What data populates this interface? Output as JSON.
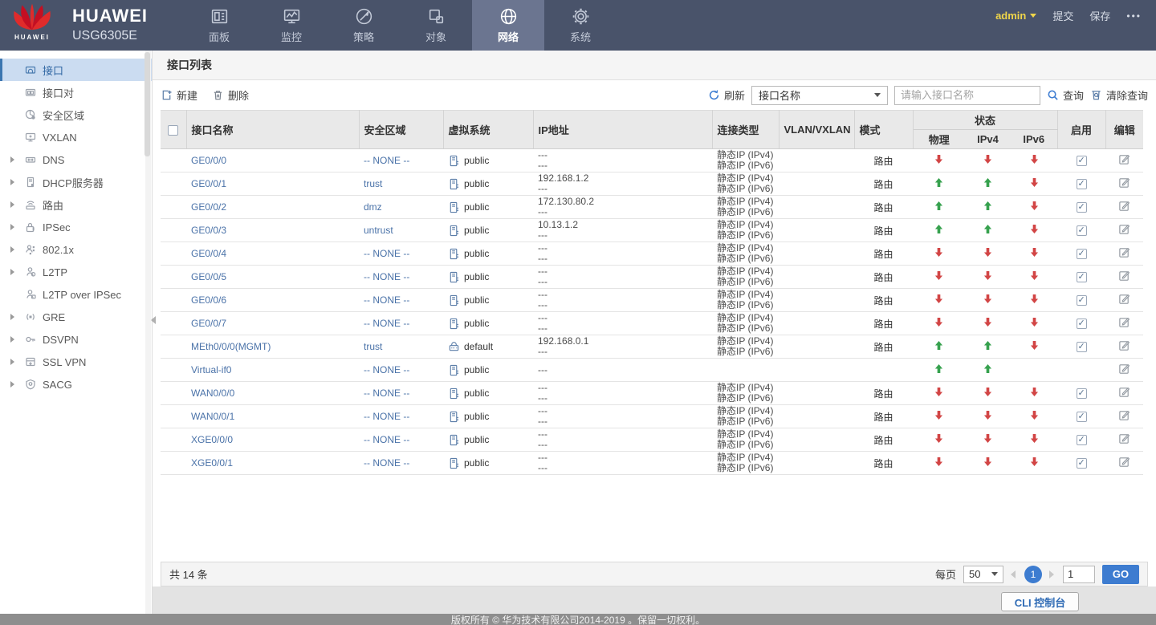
{
  "header": {
    "brand": {
      "logo_caption": "HUAWEI",
      "name": "HUAWEI",
      "model": "USG6305E"
    },
    "nav": [
      {
        "id": "dashboard",
        "label": "面板",
        "icon": "dashboard-icon"
      },
      {
        "id": "monitor",
        "label": "监控",
        "icon": "monitor-icon"
      },
      {
        "id": "policy",
        "label": "策略",
        "icon": "policy-icon"
      },
      {
        "id": "object",
        "label": "对象",
        "icon": "object-icon"
      },
      {
        "id": "network",
        "label": "网络",
        "icon": "network-icon"
      },
      {
        "id": "system",
        "label": "系统",
        "icon": "system-icon"
      }
    ],
    "active_nav": "network",
    "user": "admin",
    "submit_label": "提交",
    "save_label": "保存",
    "more_label": "•••"
  },
  "sidebar": {
    "items": [
      {
        "id": "interface",
        "label": "接口",
        "icon": "interface-icon",
        "active": true,
        "expandable": false
      },
      {
        "id": "interface-pair",
        "label": "接口对",
        "icon": "interface-pair-icon",
        "expandable": false
      },
      {
        "id": "security-zone",
        "label": "安全区域",
        "icon": "zone-icon",
        "expandable": false
      },
      {
        "id": "vxlan",
        "label": "VXLAN",
        "icon": "vxlan-icon",
        "expandable": false
      },
      {
        "id": "dns",
        "label": "DNS",
        "icon": "dns-icon",
        "expandable": true
      },
      {
        "id": "dhcp-server",
        "label": "DHCP服务器",
        "icon": "dhcp-icon",
        "expandable": true
      },
      {
        "id": "route",
        "label": "路由",
        "icon": "route-icon",
        "expandable": true
      },
      {
        "id": "ipsec",
        "label": "IPSec",
        "icon": "ipsec-icon",
        "expandable": true
      },
      {
        "id": "dot1x",
        "label": "802.1x",
        "icon": "dot1x-icon",
        "expandable": true
      },
      {
        "id": "l2tp",
        "label": "L2TP",
        "icon": "l2tp-icon",
        "expandable": true
      },
      {
        "id": "l2tp-over-ipsec",
        "label": "L2TP over IPSec",
        "icon": "l2tp-ipsec-icon",
        "expandable": false
      },
      {
        "id": "gre",
        "label": "GRE",
        "icon": "gre-icon",
        "expandable": true
      },
      {
        "id": "dsvpn",
        "label": "DSVPN",
        "icon": "dsvpn-icon",
        "expandable": true
      },
      {
        "id": "ssl-vpn",
        "label": "SSL VPN",
        "icon": "sslvpn-icon",
        "expandable": true
      },
      {
        "id": "sacg",
        "label": "SACG",
        "icon": "sacg-icon",
        "expandable": true
      }
    ]
  },
  "page": {
    "title": "接口列表"
  },
  "toolbar": {
    "new_label": "新建",
    "delete_label": "删除",
    "refresh_label": "刷新",
    "filter_selected": "接口名称",
    "search_placeholder": "请输入接口名称",
    "query_label": "查询",
    "clear_query_label": "清除查询"
  },
  "table": {
    "columns": {
      "name": "接口名称",
      "zone": "安全区域",
      "vsys": "虚拟系统",
      "ip": "IP地址",
      "conn": "连接类型",
      "vlan": "VLAN/VXLAN",
      "mode": "模式",
      "status": "状态",
      "phy": "物理",
      "ipv4": "IPv4",
      "ipv6": "IPv6",
      "enable": "启用",
      "edit": "编辑"
    },
    "rows": [
      {
        "name": "GE0/0/0",
        "zone": "-- NONE --",
        "vsys": "public",
        "vsys_icon": "vsys-public-icon",
        "ip": [
          "---",
          "---"
        ],
        "conn": [
          "静态IP (IPv4)",
          "静态IP (IPv6)"
        ],
        "vlan": "",
        "mode": "路由",
        "status": {
          "phy": "down",
          "ipv4": "down",
          "ipv6": "down"
        },
        "enabled": true
      },
      {
        "name": "GE0/0/1",
        "zone": "trust",
        "vsys": "public",
        "vsys_icon": "vsys-public-icon",
        "ip": [
          "192.168.1.2",
          "---"
        ],
        "conn": [
          "静态IP (IPv4)",
          "静态IP (IPv6)"
        ],
        "vlan": "",
        "mode": "路由",
        "status": {
          "phy": "up",
          "ipv4": "up",
          "ipv6": "down"
        },
        "enabled": true
      },
      {
        "name": "GE0/0/2",
        "zone": "dmz",
        "vsys": "public",
        "vsys_icon": "vsys-public-icon",
        "ip": [
          "172.130.80.2",
          "---"
        ],
        "conn": [
          "静态IP (IPv4)",
          "静态IP (IPv6)"
        ],
        "vlan": "",
        "mode": "路由",
        "status": {
          "phy": "up",
          "ipv4": "up",
          "ipv6": "down"
        },
        "enabled": true
      },
      {
        "name": "GE0/0/3",
        "zone": "untrust",
        "vsys": "public",
        "vsys_icon": "vsys-public-icon",
        "ip": [
          "10.13.1.2",
          "---"
        ],
        "conn": [
          "静态IP (IPv4)",
          "静态IP (IPv6)"
        ],
        "vlan": "",
        "mode": "路由",
        "status": {
          "phy": "up",
          "ipv4": "up",
          "ipv6": "down"
        },
        "enabled": true
      },
      {
        "name": "GE0/0/4",
        "zone": "-- NONE --",
        "vsys": "public",
        "vsys_icon": "vsys-public-icon",
        "ip": [
          "---",
          "---"
        ],
        "conn": [
          "静态IP (IPv4)",
          "静态IP (IPv6)"
        ],
        "vlan": "",
        "mode": "路由",
        "status": {
          "phy": "down",
          "ipv4": "down",
          "ipv6": "down"
        },
        "enabled": true
      },
      {
        "name": "GE0/0/5",
        "zone": "-- NONE --",
        "vsys": "public",
        "vsys_icon": "vsys-public-icon",
        "ip": [
          "---",
          "---"
        ],
        "conn": [
          "静态IP (IPv4)",
          "静态IP (IPv6)"
        ],
        "vlan": "",
        "mode": "路由",
        "status": {
          "phy": "down",
          "ipv4": "down",
          "ipv6": "down"
        },
        "enabled": true
      },
      {
        "name": "GE0/0/6",
        "zone": "-- NONE --",
        "vsys": "public",
        "vsys_icon": "vsys-public-icon",
        "ip": [
          "---",
          "---"
        ],
        "conn": [
          "静态IP (IPv4)",
          "静态IP (IPv6)"
        ],
        "vlan": "",
        "mode": "路由",
        "status": {
          "phy": "down",
          "ipv4": "down",
          "ipv6": "down"
        },
        "enabled": true
      },
      {
        "name": "GE0/0/7",
        "zone": "-- NONE --",
        "vsys": "public",
        "vsys_icon": "vsys-public-icon",
        "ip": [
          "---",
          "---"
        ],
        "conn": [
          "静态IP (IPv4)",
          "静态IP (IPv6)"
        ],
        "vlan": "",
        "mode": "路由",
        "status": {
          "phy": "down",
          "ipv4": "down",
          "ipv6": "down"
        },
        "enabled": true
      },
      {
        "name": "MEth0/0/0(MGMT)",
        "zone": "trust",
        "vsys": "default",
        "vsys_icon": "vsys-default-icon",
        "ip": [
          "192.168.0.1",
          "---"
        ],
        "conn": [
          "静态IP (IPv4)",
          "静态IP (IPv6)"
        ],
        "vlan": "",
        "mode": "路由",
        "status": {
          "phy": "up",
          "ipv4": "up",
          "ipv6": "down"
        },
        "enabled": true
      },
      {
        "name": "Virtual-if0",
        "zone": "-- NONE --",
        "vsys": "public",
        "vsys_icon": "vsys-public-icon",
        "ip": [
          "---"
        ],
        "conn": [],
        "vlan": "",
        "mode": "",
        "status": {
          "phy": "up",
          "ipv4": "up",
          "ipv6": ""
        },
        "enabled": false
      },
      {
        "name": "WAN0/0/0",
        "zone": "-- NONE --",
        "vsys": "public",
        "vsys_icon": "vsys-public-icon",
        "ip": [
          "---",
          "---"
        ],
        "conn": [
          "静态IP (IPv4)",
          "静态IP (IPv6)"
        ],
        "vlan": "",
        "mode": "路由",
        "status": {
          "phy": "down",
          "ipv4": "down",
          "ipv6": "down"
        },
        "enabled": true
      },
      {
        "name": "WAN0/0/1",
        "zone": "-- NONE --",
        "vsys": "public",
        "vsys_icon": "vsys-public-icon",
        "ip": [
          "---",
          "---"
        ],
        "conn": [
          "静态IP (IPv4)",
          "静态IP (IPv6)"
        ],
        "vlan": "",
        "mode": "路由",
        "status": {
          "phy": "down",
          "ipv4": "down",
          "ipv6": "down"
        },
        "enabled": true
      },
      {
        "name": "XGE0/0/0",
        "zone": "-- NONE --",
        "vsys": "public",
        "vsys_icon": "vsys-public-icon",
        "ip": [
          "---",
          "---"
        ],
        "conn": [
          "静态IP (IPv4)",
          "静态IP (IPv6)"
        ],
        "vlan": "",
        "mode": "路由",
        "status": {
          "phy": "down",
          "ipv4": "down",
          "ipv6": "down"
        },
        "enabled": true
      },
      {
        "name": "XGE0/0/1",
        "zone": "-- NONE --",
        "vsys": "public",
        "vsys_icon": "vsys-public-icon",
        "ip": [
          "---",
          "---"
        ],
        "conn": [
          "静态IP (IPv4)",
          "静态IP (IPv6)"
        ],
        "vlan": "",
        "mode": "路由",
        "status": {
          "phy": "down",
          "ipv4": "down",
          "ipv6": "down"
        },
        "enabled": true
      }
    ]
  },
  "pagination": {
    "total": "共 14 条",
    "per_page_label": "每页",
    "per_page": "50",
    "current_page": "1",
    "goto_value": "1",
    "go_label": "GO"
  },
  "footer": {
    "cli_label": "CLI 控制台",
    "copyright": "版权所有 © 华为技术有限公司2014-2019 。保留一切权利。"
  },
  "colors": {
    "navbar_bg": "#49536a",
    "navbar_active_bg": "#6b7590",
    "accent_blue": "#3d7cd0",
    "link_blue": "#4a72a8",
    "status_up_green": "#36a14e",
    "status_down_red": "#d24545",
    "admin_yellow": "#f0d64a",
    "sidebar_active_bg": "#cbdcf1"
  }
}
